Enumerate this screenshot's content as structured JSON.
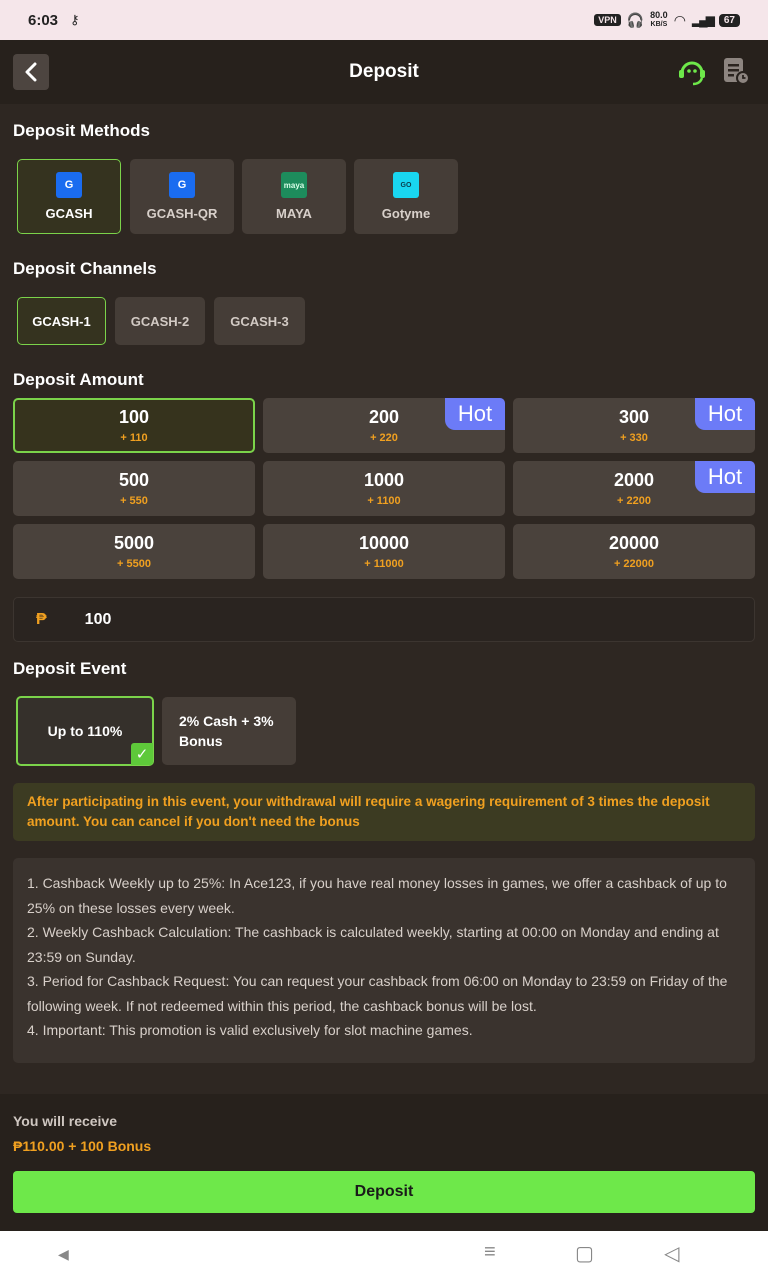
{
  "status": {
    "time": "6:03",
    "vpn": "VPN",
    "speed_value": "80.0",
    "speed_unit": "KB/S",
    "battery": "67"
  },
  "header": {
    "title": "Deposit"
  },
  "methods": {
    "title": "Deposit Methods",
    "items": [
      {
        "label": "GCASH",
        "logo": "G"
      },
      {
        "label": "GCASH-QR",
        "logo": "G"
      },
      {
        "label": "MAYA",
        "logo": "maya"
      },
      {
        "label": "Gotyme",
        "logo": "GO"
      }
    ]
  },
  "channels": {
    "title": "Deposit Channels",
    "items": [
      {
        "label": "GCASH-1"
      },
      {
        "label": "GCASH-2"
      },
      {
        "label": "GCASH-3"
      }
    ]
  },
  "amounts": {
    "title": "Deposit Amount",
    "hot_label": "Hot",
    "items": [
      {
        "value": "100",
        "bonus": "+ 110"
      },
      {
        "value": "200",
        "bonus": "+ 220"
      },
      {
        "value": "300",
        "bonus": "+ 330"
      },
      {
        "value": "500",
        "bonus": "+ 550"
      },
      {
        "value": "1000",
        "bonus": "+ 1100"
      },
      {
        "value": "2000",
        "bonus": "+ 2200"
      },
      {
        "value": "5000",
        "bonus": "+ 5500"
      },
      {
        "value": "10000",
        "bonus": "+ 11000"
      },
      {
        "value": "20000",
        "bonus": "+ 22000"
      }
    ]
  },
  "input": {
    "currency": "₱",
    "value": "100"
  },
  "events": {
    "title": "Deposit Event",
    "items": [
      {
        "label": "Up to 110%"
      },
      {
        "line1": "2% Cash + 3%",
        "line2": "Bonus"
      }
    ]
  },
  "warning": "After participating in this event, your withdrawal will require a wagering requirement of 3 times the deposit amount. You can cancel if you don't need the bonus",
  "rules": [
    "1. Cashback Weekly up to 25%: In Ace123, if you have real money losses in games, we offer a cashback of up to 25% on these losses every week.",
    "2. Weekly Cashback Calculation: The cashback is calculated weekly, starting at 00:00 on Monday and ending at 23:59 on Sunday.",
    "3. Period for Cashback Request: You can request your cashback from 06:00 on Monday to 23:59 on Friday of the following week. If not redeemed within this period, the cashback bonus will be lost.",
    "4. Important: This promotion is valid exclusively for slot machine games."
  ],
  "footer": {
    "receive_label": "You will receive",
    "receive_value": "₱110.00 + 100 Bonus",
    "deposit_label": "Deposit"
  },
  "colors": {
    "accent": "#6ee84a",
    "bonus": "#f0a020",
    "hot": "#6c7bf7"
  }
}
